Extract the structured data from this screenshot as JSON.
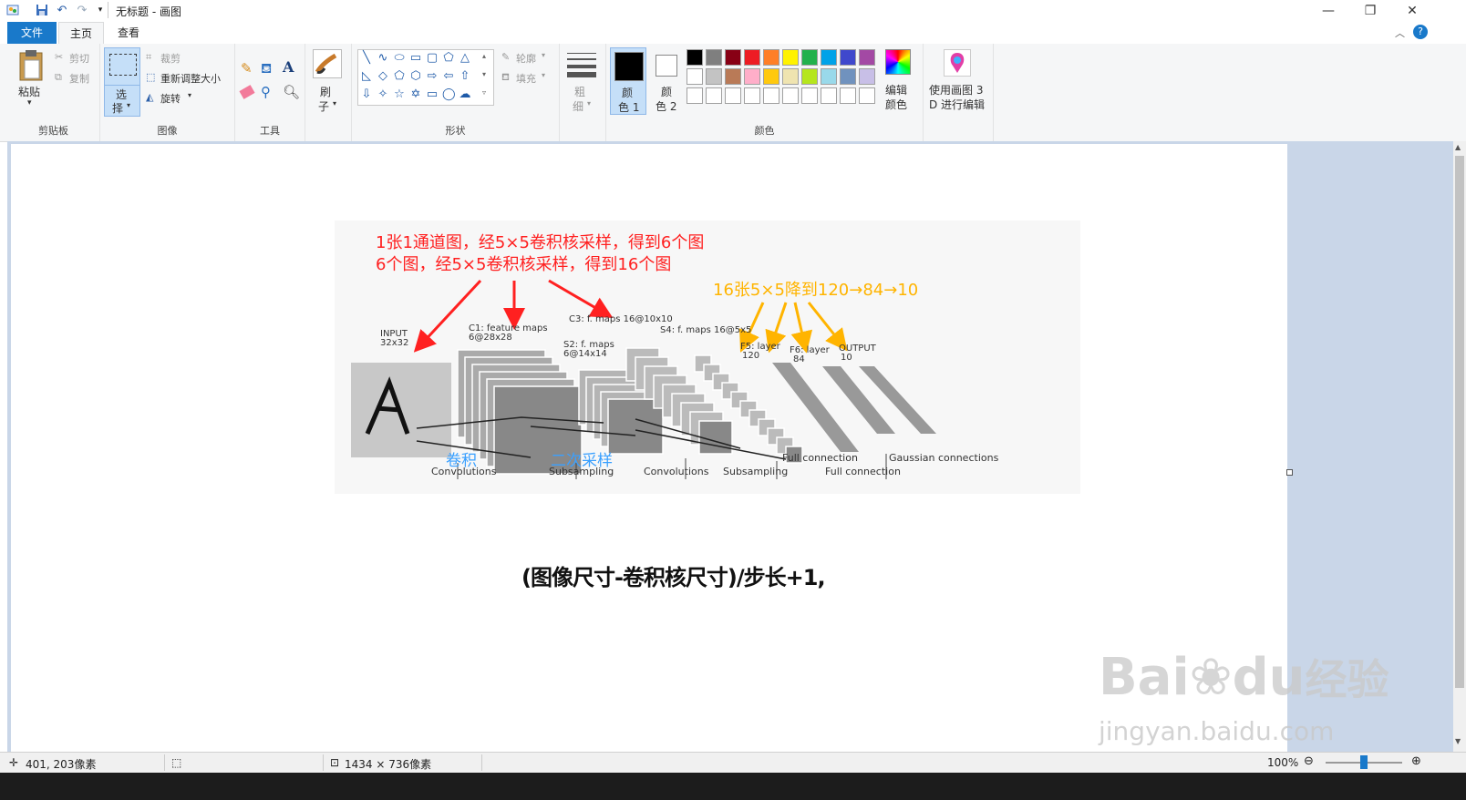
{
  "title": {
    "text": "无标题 - 画图"
  },
  "tabs": {
    "file": "文件",
    "home": "主页",
    "view": "查看"
  },
  "clipboard": {
    "paste": "粘贴",
    "cut": "剪切",
    "copy": "复制",
    "label": "剪贴板"
  },
  "image": {
    "select": "选",
    "select2": "择",
    "crop": "裁剪",
    "resize": "重新调整大小",
    "rotate": "旋转",
    "label": "图像"
  },
  "tools": {
    "label": "工具",
    "text_tool": "A"
  },
  "brushes": {
    "line1": "刷",
    "line2": "子"
  },
  "shapes": {
    "outline": "轮廓",
    "fill": "填充",
    "label": "形状"
  },
  "size": {
    "line1": "粗",
    "line2": "细"
  },
  "colors": {
    "color1_l1": "颜",
    "color1_l2": "色 1",
    "color2_l1": "颜",
    "color2_l2": "色 2",
    "edit_l1": "编辑",
    "edit_l2": "颜色",
    "label": "颜色",
    "row1": [
      "#000000",
      "#7f7f7f",
      "#880015",
      "#ed1c24",
      "#ff7f27",
      "#fff200",
      "#22b14c",
      "#00a2e8",
      "#3f48cc",
      "#a349a4"
    ],
    "row2": [
      "#ffffff",
      "#c3c3c3",
      "#b97a57",
      "#ffaec9",
      "#ffc90e",
      "#efe4b0",
      "#b5e61d",
      "#99d9ea",
      "#7092be",
      "#c8bfe7"
    ]
  },
  "paint3d": {
    "l1": "使用画图 3",
    "l2": "D 进行编辑"
  },
  "canvas": {
    "ann_red1": "1张1通道图，经5×5卷积核采样，得到6个图",
    "ann_red2": "6个图，经5×5卷积核采样，得到16个图",
    "ann_yellow": "16张5×5降到120→84→10",
    "ann_blue1": "卷积",
    "ann_blue2": "二次采样",
    "input_l1": "INPUT",
    "input_l2": "32x32",
    "c1_l1": "C1: feature maps",
    "c1_l2": "6@28x28",
    "c3": "C3: f. maps 16@10x10",
    "s2_l1": "S2: f. maps",
    "s2_l2": "6@14x14",
    "s4": "S4: f. maps 16@5x5",
    "f5_l1": "F5: layer",
    "f5_l2": "120",
    "f6_l1": "F6: layer",
    "f6_l2": "84",
    "out_l1": "OUTPUT",
    "out_l2": "10",
    "b_conv1": "Convolutions",
    "b_sub1": "Subsampling",
    "b_conv2": "Convolutions",
    "b_sub2": "Subsampling",
    "b_full1": "Full connection",
    "b_full2": "Full connection",
    "b_gauss": "Gaussian connections",
    "formula": "(图像尺寸-卷积核尺寸)/步长+1,"
  },
  "watermark": {
    "brand": "Bai",
    "brand2": "du",
    "brand3": "经验",
    "url": "jingyan.baidu.com"
  },
  "status": {
    "cursor": "401, 203像素",
    "dims": "1434 × 736像素",
    "zoom": "100%"
  }
}
